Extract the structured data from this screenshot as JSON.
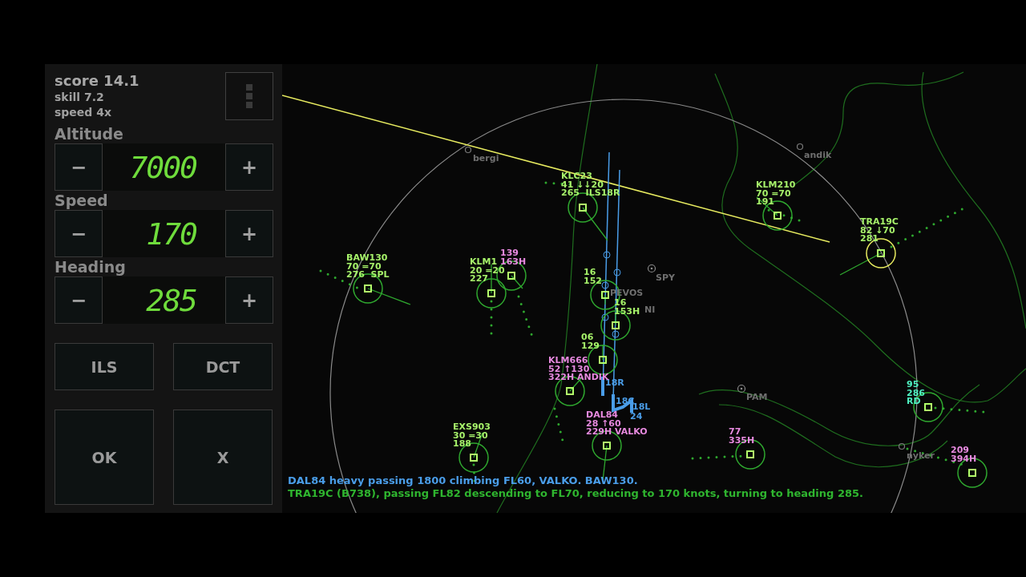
{
  "panel": {
    "score": "score 14.1",
    "skill": "skill 7.2",
    "speed": "speed 4x",
    "controls": [
      {
        "label": "Altitude",
        "minus": "−",
        "value": "7000",
        "plus": "+"
      },
      {
        "label": "Speed",
        "minus": "−",
        "value": "170",
        "plus": "+"
      },
      {
        "label": "Heading",
        "minus": "−",
        "value": "285",
        "plus": "+"
      }
    ],
    "buttons": [
      "ILS",
      "DCT",
      "OK",
      "X"
    ]
  },
  "radar": {
    "aircraft": [
      {
        "lines": [
          "KLC23",
          "41 ↓↓20",
          "265  ILS18R"
        ],
        "color": "#a6f26a",
        "selected": false
      },
      {
        "lines": [
          "KLM210",
          "70 =70",
          "191"
        ],
        "color": "#a6f26a",
        "selected": false
      },
      {
        "lines": [
          "TRA19C",
          "82 ↓70",
          "281"
        ],
        "color": "#a6f26a",
        "selected": true
      },
      {
        "lines": [
          "BAW130",
          "70 =70",
          "276  SPL"
        ],
        "color": "#a6f26a",
        "selected": false
      },
      {
        "lines": [
          "KLM1",
          "20 =20",
          "227"
        ],
        "color": "#a6f26a",
        "selected": false
      },
      {
        "lines": [
          "139",
          "163H"
        ],
        "color": "#e88ae0",
        "selected": false
      },
      {
        "lines": [
          "16",
          "152"
        ],
        "color": "#a6f26a",
        "selected": false
      },
      {
        "lines": [
          "16",
          "153H"
        ],
        "color": "#a6f26a",
        "selected": false
      },
      {
        "lines": [
          "06",
          "129"
        ],
        "color": "#a6f26a",
        "selected": false
      },
      {
        "lines": [
          "KLM666",
          "52 ↑130",
          "322H ANDIK"
        ],
        "color": "#e88ae0",
        "selected": false
      },
      {
        "lines": [
          "DAL84",
          "28 ↑60",
          "229H VALKO"
        ],
        "color": "#e88ae0",
        "selected": false
      },
      {
        "lines": [
          "EXS903",
          "30 =30",
          "188"
        ],
        "color": "#a6f26a",
        "selected": false
      },
      {
        "lines": [
          "77",
          "335H"
        ],
        "color": "#e88ae0",
        "selected": false
      },
      {
        "lines": [
          "95",
          "286",
          "RD"
        ],
        "color": "#4ef0c0",
        "selected": false
      },
      {
        "lines": [
          "209",
          "394H"
        ],
        "color": "#e88ae0",
        "selected": false
      }
    ],
    "fixes": [
      {
        "name": "bergi",
        "kind": "waypoint"
      },
      {
        "name": "andik",
        "kind": "waypoint"
      },
      {
        "name": "SPY",
        "kind": "vor"
      },
      {
        "name": "PEVOS",
        "kind": "none"
      },
      {
        "name": "NI",
        "kind": "none"
      },
      {
        "name": "PAM",
        "kind": "vor"
      },
      {
        "name": "nyker",
        "kind": "waypoint"
      }
    ],
    "runways": [
      "18R",
      "18C",
      "18L",
      "24"
    ]
  },
  "messages": [
    {
      "text": "DAL84 heavy passing 1800 climbing FL60, VALKO. BAW130.",
      "color": "#4a9de8"
    },
    {
      "text": "TRA19C (B738), passing FL82 descending to FL70, reducing to 170 knots, turning to heading 285.",
      "color": "#2fb52f"
    }
  ]
}
